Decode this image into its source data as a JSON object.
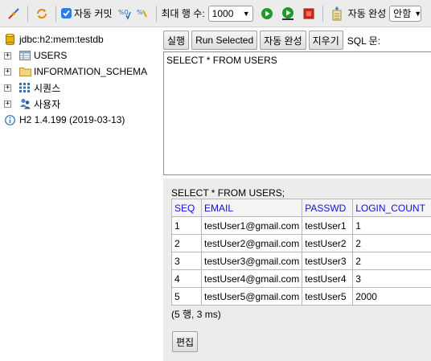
{
  "toolbar": {
    "auto_commit_label": "자동 커밋",
    "max_rows_label": "최대 행 수:",
    "max_rows_value": "1000",
    "auto_complete_label": "자동 완성",
    "auto_complete_value": "안함"
  },
  "tree": {
    "connection": "jdbc:h2:mem:testdb",
    "items": [
      {
        "label": "USERS",
        "icon": "table-icon"
      },
      {
        "label": "INFORMATION_SCHEMA",
        "icon": "folder-icon"
      },
      {
        "label": "시퀀스",
        "icon": "sequence-icon"
      },
      {
        "label": "사용자",
        "icon": "users-icon"
      }
    ],
    "version": "H2 1.4.199 (2019-03-13)"
  },
  "sql_toolbar": {
    "run": "실행",
    "run_selected": "Run Selected",
    "auto_complete": "자동 완성",
    "clear": "지우기",
    "sql_label": "SQL 문:"
  },
  "editor": {
    "text": "SELECT * FROM USERS"
  },
  "result": {
    "statement": "SELECT * FROM USERS;",
    "columns": [
      "SEQ",
      "EMAIL",
      "PASSWD",
      "LOGIN_COUNT"
    ],
    "rows": [
      [
        "1",
        "testUser1@gmail.com",
        "testUser1",
        "1"
      ],
      [
        "2",
        "testUser2@gmail.com",
        "testUser2",
        "2"
      ],
      [
        "3",
        "testUser3@gmail.com",
        "testUser3",
        "2"
      ],
      [
        "4",
        "testUser4@gmail.com",
        "testUser4",
        "3"
      ],
      [
        "5",
        "testUser5@gmail.com",
        "testUser5",
        "2000"
      ]
    ],
    "summary": "(5 행, 3 ms)",
    "edit_button": "편집"
  },
  "colors": {
    "header_text": "#1010d8",
    "checkbox": "#2a7de1",
    "run_green": "#1f9a2b",
    "stop_red": "#d9261c"
  }
}
